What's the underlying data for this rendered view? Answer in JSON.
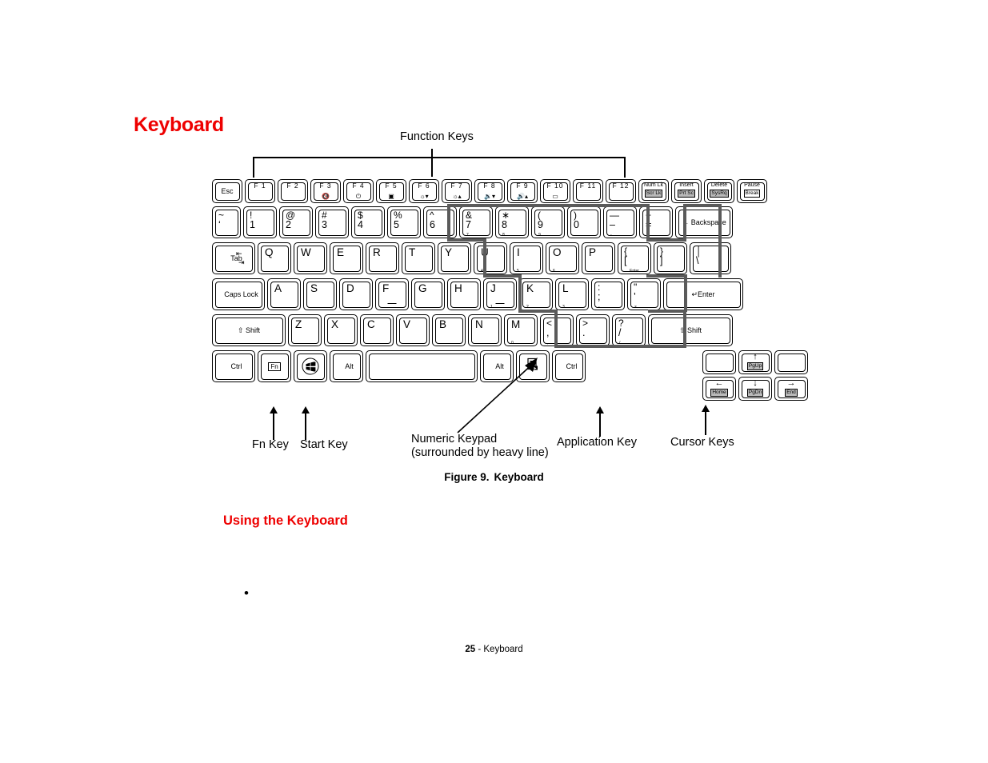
{
  "page": {
    "title": "Keyboard",
    "subheading": "Using the Keyboard",
    "bullet_marker": "•",
    "figure_caption_number": "Figure 9.",
    "figure_caption_text": "Keyboard",
    "footer_page": "25",
    "footer_sep": " - ",
    "footer_section": "Keyboard",
    "accent_color": "#ee0000",
    "heavy_line_color": "#5a5a5a"
  },
  "callouts": {
    "function_keys": "Function Keys",
    "fn_key": "Fn Key",
    "start_key": "Start Key",
    "numeric_keypad_line1": "Numeric Keypad",
    "numeric_keypad_line2": "(surrounded by heavy line)",
    "application_key": "Application Key",
    "cursor_keys": "Cursor Keys"
  },
  "keyboard": {
    "rows": [
      {
        "name": "function-row",
        "keys": [
          {
            "name": "esc",
            "label": "Esc"
          },
          {
            "name": "f1",
            "top": "F 1"
          },
          {
            "name": "f2",
            "top": "F 2"
          },
          {
            "name": "f3",
            "top": "F 3",
            "icon": "mute-icon",
            "glyph": "🔇"
          },
          {
            "name": "f4",
            "top": "F 4",
            "icon": "power-icon",
            "glyph": "⏻"
          },
          {
            "name": "f5",
            "top": "F 5",
            "icon": "display-switch-icon",
            "glyph": "▣"
          },
          {
            "name": "f6",
            "top": "F 6",
            "icon": "brightness-down-icon",
            "glyph": "☼▾"
          },
          {
            "name": "f7",
            "top": "F 7",
            "icon": "brightness-up-icon",
            "glyph": "☼▴"
          },
          {
            "name": "f8",
            "top": "F 8",
            "icon": "volume-down-icon",
            "glyph": "🔉▾"
          },
          {
            "name": "f9",
            "top": "F 9",
            "icon": "volume-up-icon",
            "glyph": "🔊▴"
          },
          {
            "name": "f10",
            "top": "F 10",
            "icon": "screen-icon",
            "glyph": "▭"
          },
          {
            "name": "f11",
            "top": "F 11"
          },
          {
            "name": "f12",
            "top": "F 12"
          },
          {
            "name": "numlk",
            "top": "Num Lk",
            "boxed": "Scr Lk",
            "shaded": true
          },
          {
            "name": "insert",
            "top": "Insert",
            "boxed": "Prt Sc",
            "shaded": true
          },
          {
            "name": "delete",
            "top": "Delete",
            "boxed": "SysRq",
            "shaded": true
          },
          {
            "name": "pause",
            "top": "Pause",
            "boxed": "Break"
          }
        ]
      },
      {
        "name": "number-row",
        "keys": [
          {
            "name": "grave",
            "up": "~",
            "dn": "‘"
          },
          {
            "name": "digit-1",
            "up": "!",
            "dn": "1"
          },
          {
            "name": "digit-2",
            "up": "@",
            "dn": "2"
          },
          {
            "name": "digit-3",
            "up": "#",
            "dn": "3"
          },
          {
            "name": "digit-4",
            "up": "$",
            "dn": "4"
          },
          {
            "name": "digit-5",
            "up": "%",
            "dn": "5"
          },
          {
            "name": "digit-6",
            "up": "^",
            "dn": "6"
          },
          {
            "name": "digit-7",
            "up": "&",
            "dn": "7",
            "sub": "7"
          },
          {
            "name": "digit-8",
            "up": "∗",
            "dn": "8",
            "sub": "8"
          },
          {
            "name": "digit-9",
            "up": "(",
            "dn": "9",
            "sub": "9"
          },
          {
            "name": "digit-0",
            "up": ")",
            "dn": "0"
          },
          {
            "name": "minus",
            "up": "—",
            "dn": "–",
            "sub": "-"
          },
          {
            "name": "equals",
            "up": "+",
            "dn": "="
          },
          {
            "name": "backspace",
            "label": "← Backspace"
          }
        ]
      },
      {
        "name": "qwerty-row",
        "keys": [
          {
            "name": "tab",
            "label": "Tab"
          },
          {
            "name": "key-q",
            "alpha": "Q"
          },
          {
            "name": "key-w",
            "alpha": "W"
          },
          {
            "name": "key-e",
            "alpha": "E"
          },
          {
            "name": "key-r",
            "alpha": "R"
          },
          {
            "name": "key-t",
            "alpha": "T"
          },
          {
            "name": "key-y",
            "alpha": "Y"
          },
          {
            "name": "key-u",
            "alpha": "U",
            "sub": "4"
          },
          {
            "name": "key-i",
            "alpha": "I",
            "sub": "5"
          },
          {
            "name": "key-o",
            "alpha": "O",
            "sub": "6"
          },
          {
            "name": "key-p",
            "alpha": "P"
          },
          {
            "name": "bracket-left",
            "up": "{",
            "dn": "[",
            "sub": "Enter"
          },
          {
            "name": "bracket-right",
            "up": "}",
            "dn": "]"
          },
          {
            "name": "backslash",
            "up": "│",
            "dn": "\\"
          }
        ]
      },
      {
        "name": "home-row",
        "keys": [
          {
            "name": "caps-lock",
            "label": "Caps Lock"
          },
          {
            "name": "key-a",
            "alpha": "A"
          },
          {
            "name": "key-s",
            "alpha": "S"
          },
          {
            "name": "key-d",
            "alpha": "D"
          },
          {
            "name": "key-f",
            "alpha": "F",
            "home": true
          },
          {
            "name": "key-g",
            "alpha": "G"
          },
          {
            "name": "key-h",
            "alpha": "H"
          },
          {
            "name": "key-j",
            "alpha": "J",
            "sub": "1",
            "home": true
          },
          {
            "name": "key-k",
            "alpha": "K",
            "sub": "2"
          },
          {
            "name": "key-l",
            "alpha": "L",
            "sub": "3"
          },
          {
            "name": "semicolon",
            "up": ":",
            "dn": ";",
            "sub": "-"
          },
          {
            "name": "quote",
            "up": "\"",
            "dn": "’",
            "sub": "×"
          },
          {
            "name": "enter",
            "label": "↵Enter"
          }
        ]
      },
      {
        "name": "shift-row",
        "keys": [
          {
            "name": "shift-left",
            "label": "⇧ Shift"
          },
          {
            "name": "key-z",
            "alpha": "Z"
          },
          {
            "name": "key-x",
            "alpha": "X"
          },
          {
            "name": "key-c",
            "alpha": "C"
          },
          {
            "name": "key-v",
            "alpha": "V"
          },
          {
            "name": "key-b",
            "alpha": "B"
          },
          {
            "name": "key-n",
            "alpha": "N"
          },
          {
            "name": "key-m",
            "alpha": "M",
            "sub": "0"
          },
          {
            "name": "comma",
            "up": "<",
            "dn": ",",
            "sub": ","
          },
          {
            "name": "period",
            "up": ">",
            "dn": ".",
            "sub": "."
          },
          {
            "name": "slash",
            "up": "?",
            "dn": "/",
            "sub": "/"
          },
          {
            "name": "shift-right",
            "label": "⇧ Shift"
          }
        ]
      },
      {
        "name": "bottom-row",
        "keys": [
          {
            "name": "ctrl-left",
            "label": "Ctrl"
          },
          {
            "name": "fn",
            "label": "Fn",
            "boxedInline": true
          },
          {
            "name": "start-key",
            "icon": "windows-start-icon"
          },
          {
            "name": "alt-left",
            "label": "Alt"
          },
          {
            "name": "space",
            "label": ""
          },
          {
            "name": "alt-right",
            "label": "Alt"
          },
          {
            "name": "application-key",
            "icon": "application-menu-icon"
          },
          {
            "name": "ctrl-right",
            "label": "Ctrl"
          }
        ]
      }
    ],
    "cursor_keys": [
      {
        "name": "arrow-up",
        "glyph": "↑",
        "boxed": "PgUp"
      },
      {
        "name": "arrow-left",
        "glyph": "←",
        "boxed": "Home"
      },
      {
        "name": "arrow-down",
        "glyph": "↓",
        "boxed": "PgDn"
      },
      {
        "name": "arrow-right",
        "glyph": "→",
        "boxed": "End"
      }
    ]
  }
}
